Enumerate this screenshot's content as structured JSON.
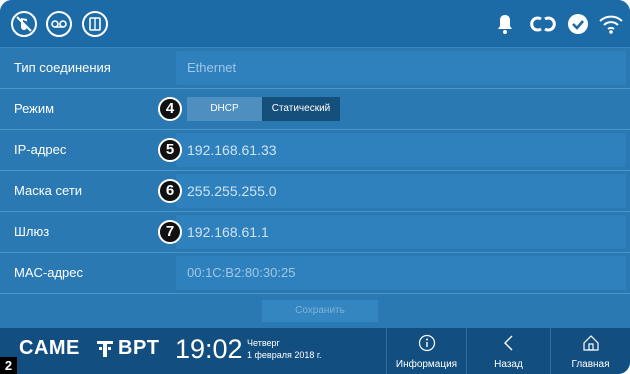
{
  "topbar": {
    "left_icons": [
      "mute-icon",
      "voicemail-icon",
      "phonebook-icon"
    ],
    "right_icons": [
      "bell-icon",
      "link-icon",
      "check-circle-icon",
      "wifi-icon"
    ]
  },
  "form": {
    "connection_type": {
      "label": "Тип соединения",
      "value": "Ethernet"
    },
    "mode": {
      "label": "Режим",
      "badge": "4",
      "options": [
        "DHCP",
        "Статический"
      ],
      "selected": "DHCP"
    },
    "ip": {
      "label": "IP-адрес",
      "badge": "5",
      "value": "192.168.61.33"
    },
    "mask": {
      "label": "Маска сети",
      "badge": "6",
      "value": "255.255.255.0"
    },
    "gateway": {
      "label": "Шлюз",
      "badge": "7",
      "value": "192.168.61.1"
    },
    "mac": {
      "label": "MAC-адрес",
      "value": "00:1C:B2:80:30:25"
    }
  },
  "save_label": "Сохранить",
  "bottombar": {
    "brand_came": "CAME",
    "brand_bpt": "BPT",
    "time": "19:02",
    "day": "Четверг",
    "date": "1 февраля 2018 г.",
    "nav": [
      {
        "label": "Информация",
        "icon": "info-icon"
      },
      {
        "label": "Назад",
        "icon": "back-chevron-icon"
      },
      {
        "label": "Главная",
        "icon": "home-icon"
      }
    ]
  },
  "page_number": "2",
  "colors": {
    "panel": "#2a79b3",
    "topbar": "#1c6aa6",
    "bottombar": "#124f80",
    "badge": "#111111"
  }
}
